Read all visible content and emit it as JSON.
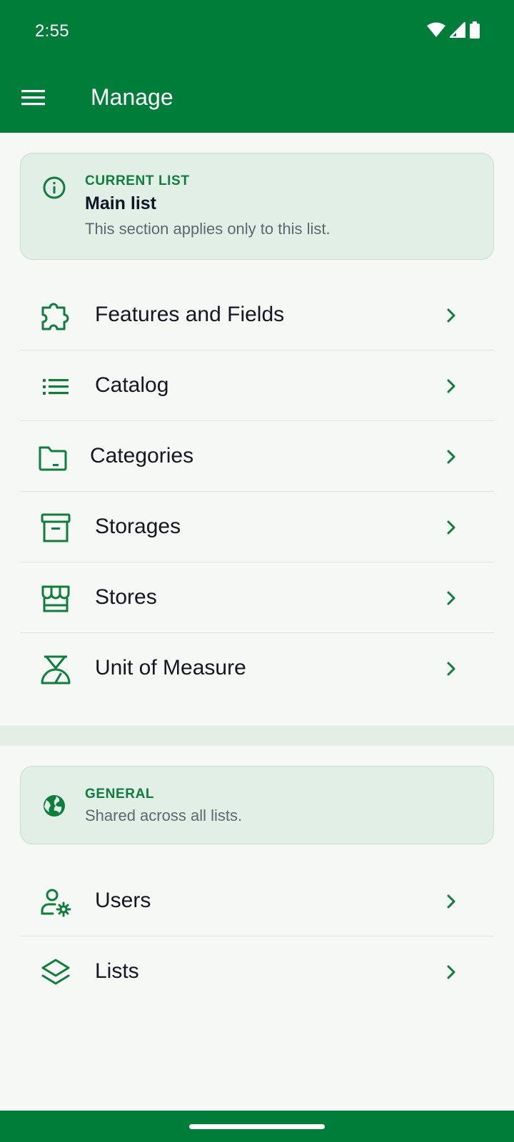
{
  "status_bar": {
    "time": "2:55"
  },
  "app_bar": {
    "title": "Manage",
    "menu_icon": "menu-icon"
  },
  "current_list_card": {
    "icon": "info-icon",
    "eyebrow": "CURRENT LIST",
    "title": "Main list",
    "subtitle": "This section applies only to this list."
  },
  "current_list_items": [
    {
      "label": "Features and Fields",
      "icon": "puzzle-icon"
    },
    {
      "label": "Catalog",
      "icon": "list-icon"
    },
    {
      "label": "Categories",
      "icon": "folder-icon"
    },
    {
      "label": "Storages",
      "icon": "archive-icon"
    },
    {
      "label": "Stores",
      "icon": "store-icon"
    },
    {
      "label": "Unit of Measure",
      "icon": "scale-icon"
    }
  ],
  "general_card": {
    "icon": "globe-icon",
    "eyebrow": "GENERAL",
    "subtitle": "Shared across all lists."
  },
  "general_items": [
    {
      "label": "Users",
      "icon": "user-settings-icon"
    },
    {
      "label": "Lists",
      "icon": "layers-icon"
    }
  ],
  "colors": {
    "primary": "#017d3a",
    "card_bg": "#e1efe6",
    "background": "#f5f8f5"
  }
}
